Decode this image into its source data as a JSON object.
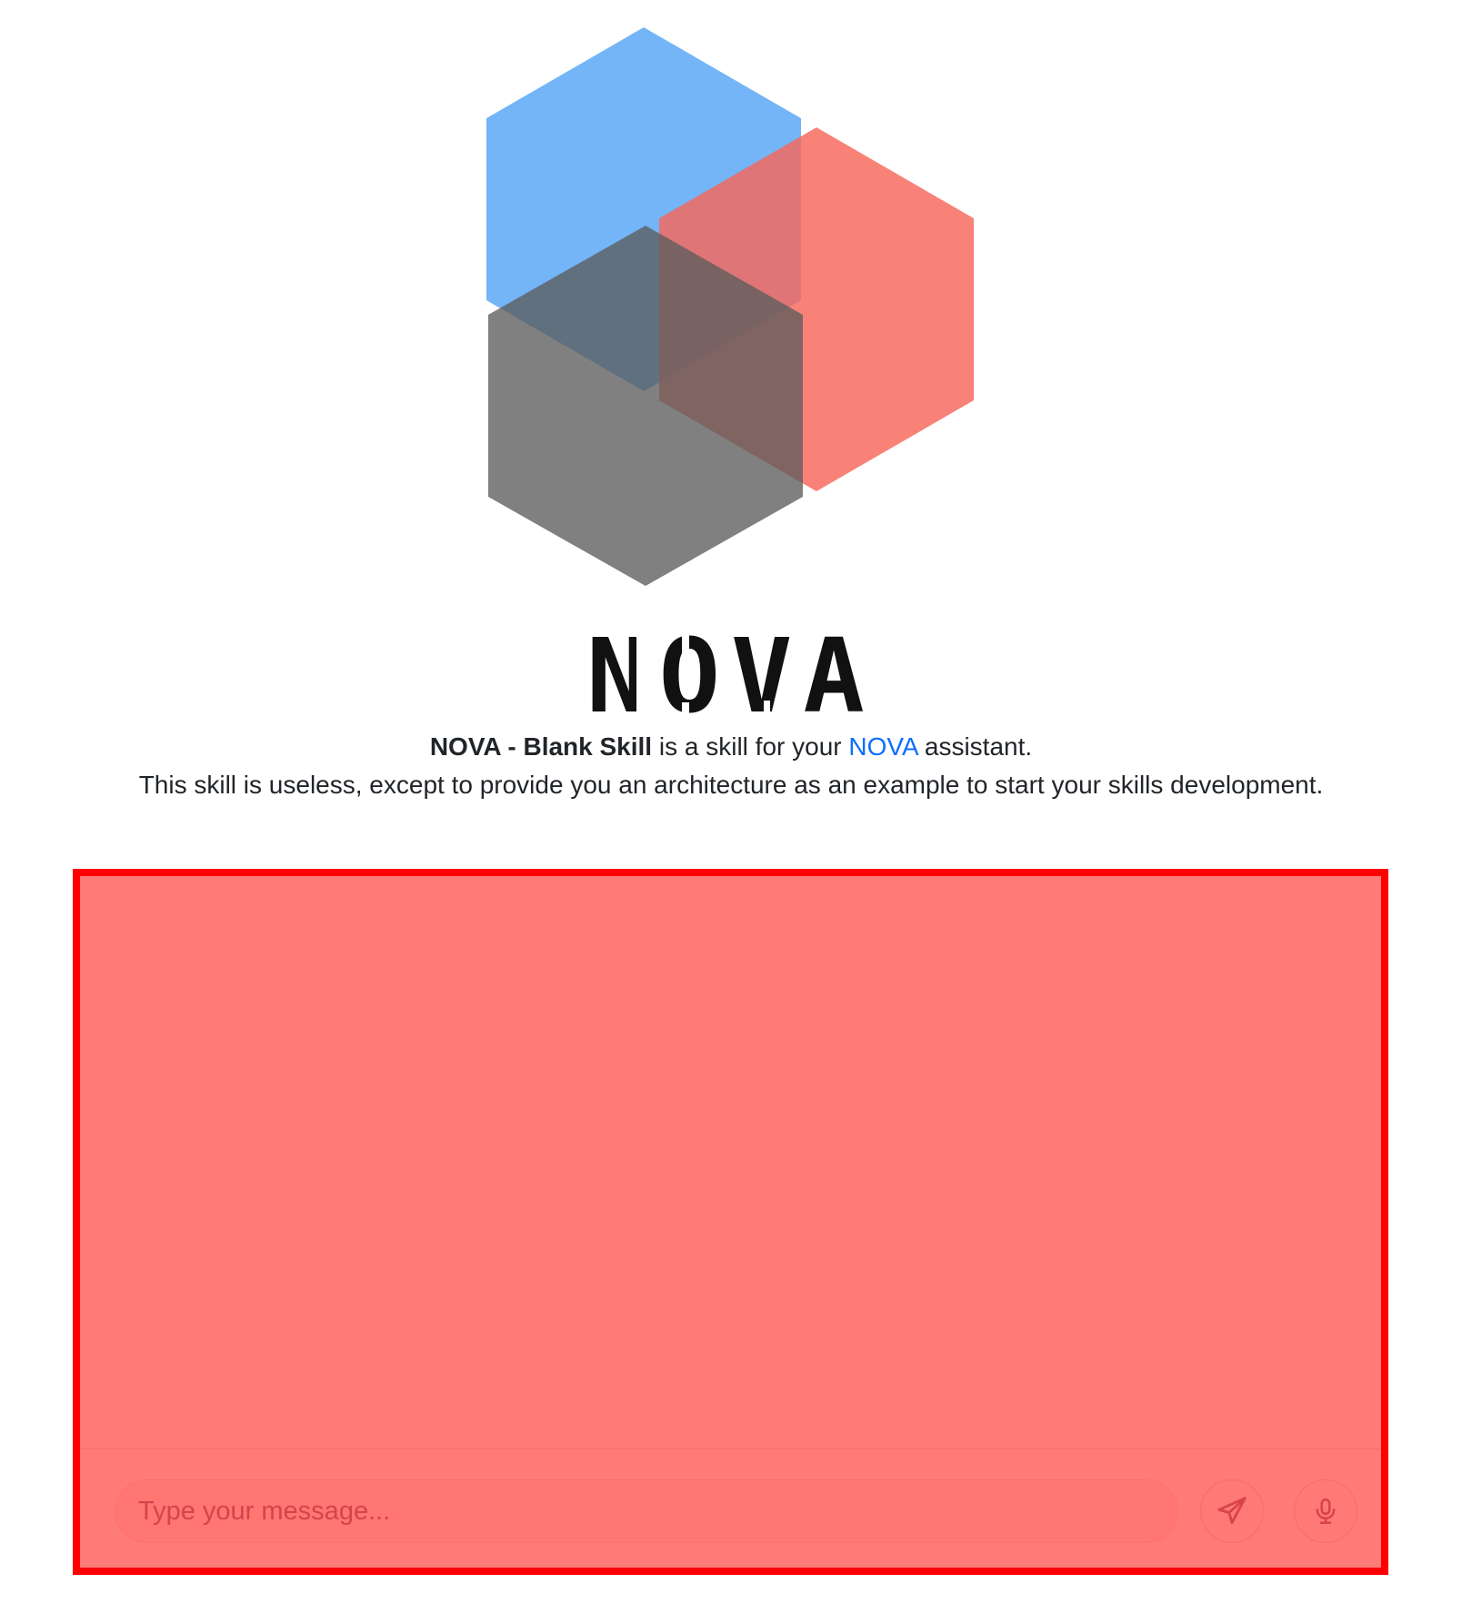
{
  "brand": {
    "wordmark": "NOVA",
    "colors": {
      "hex_blue": "#5aa8f6",
      "hex_red": "#f6675a",
      "hex_gray": "#5c5c5c",
      "text": "#212529",
      "link": "#0d6efd",
      "chat_overlay": "#ff7b77",
      "chat_border": "#ff0000"
    }
  },
  "intro": {
    "skill_name": "NOVA - Blank Skill",
    "line1_middle": " is a skill for your ",
    "link_text": "NOVA",
    "line1_end": " assistant.",
    "line2": "This skill is useless, except to provide you an architecture as an example to start your skills development."
  },
  "chat": {
    "input_placeholder": "Type your message...",
    "input_value": "",
    "send_icon": "paper-plane-icon",
    "mic_icon": "microphone-icon"
  }
}
